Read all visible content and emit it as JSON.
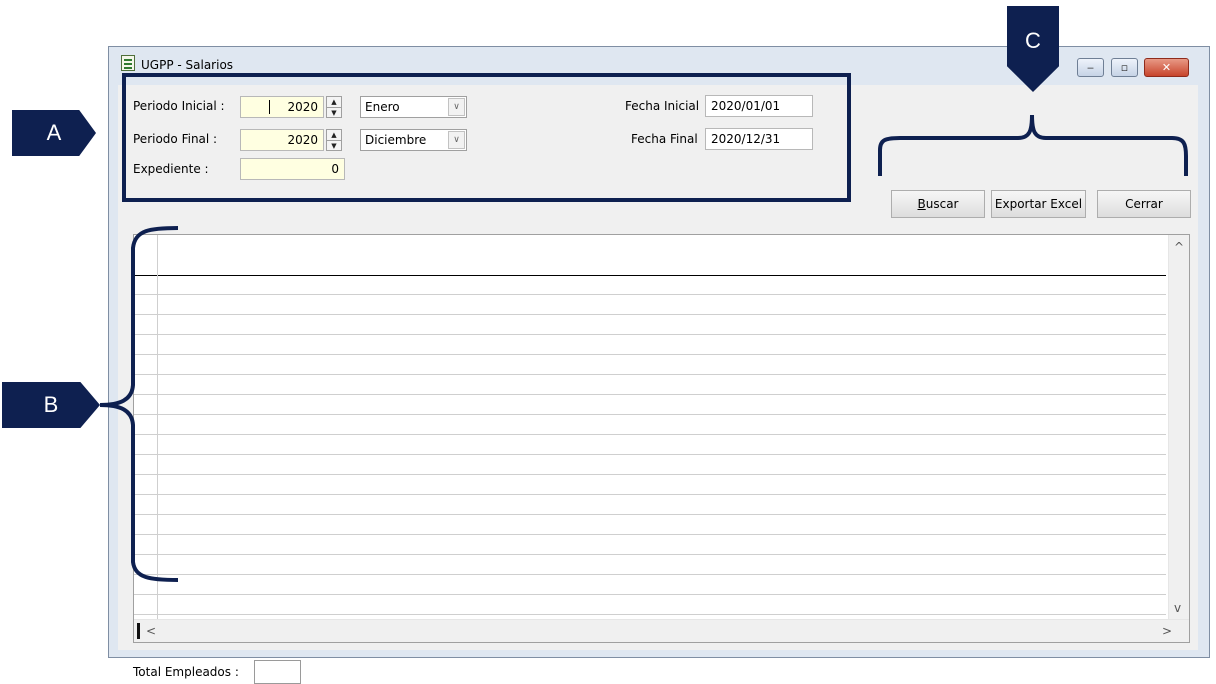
{
  "window": {
    "title": "UGPP - Salarios",
    "min_label": "‒",
    "max_label": "▫",
    "close_label": "✕"
  },
  "filters": {
    "periodo_inicial_label": "Periodo Inicial :",
    "periodo_inicial_year": "2020",
    "periodo_inicial_month": "Enero",
    "periodo_final_label": "Periodo Final :",
    "periodo_final_year": "2020",
    "periodo_final_month": "Diciembre",
    "expediente_label": "Expediente :",
    "expediente_value": "0",
    "fecha_inicial_label": "Fecha Inicial",
    "fecha_inicial_value": "2020/01/01",
    "fecha_final_label": "Fecha Final",
    "fecha_final_value": "2020/12/31"
  },
  "buttons": {
    "buscar_first": "B",
    "buscar_rest": "uscar",
    "exportar": "Exportar Excel",
    "cerrar": "Cerrar"
  },
  "scroll": {
    "up": "^",
    "down": "v",
    "left": "<",
    "right": ">"
  },
  "footer": {
    "total_label": "Total Empleados :"
  },
  "annotations": {
    "a": "A",
    "b": "B",
    "c": "C"
  },
  "colors": {
    "annotation": "#0e2050",
    "input_yellow": "#ffffe1",
    "window_frame": "#dfe7f1"
  }
}
